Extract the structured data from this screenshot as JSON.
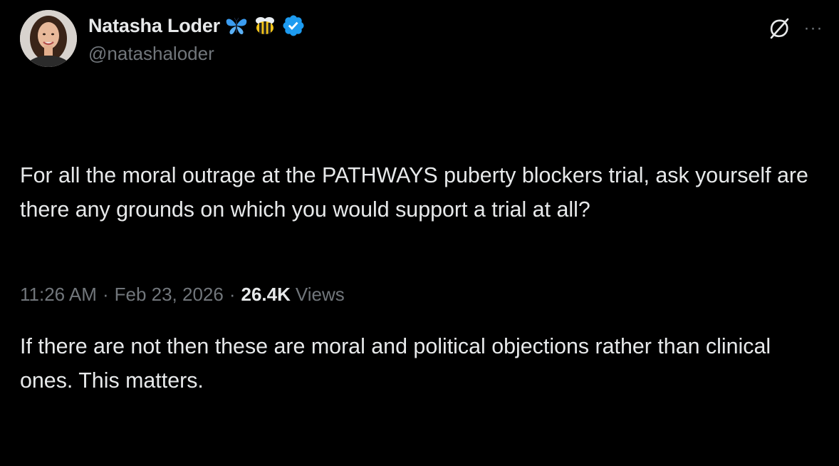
{
  "tweet": {
    "author": {
      "display_name": "Natasha Loder",
      "handle": "@natashaloder",
      "emojis": [
        "butterfly-emoji",
        "bee-emoji"
      ],
      "verified_icon": "verified-badge-icon",
      "verified_color": "#1d9bf0"
    },
    "text": {
      "paragraph_1": "For all the moral outrage at the PATHWAYS puberty blockers trial, ask yourself are there any grounds on which you would support a trial at all?",
      "paragraph_2": "If there are not then these are moral and political objections rather than clinical ones. This matters."
    },
    "meta": {
      "time": "11:26 AM",
      "separator": "·",
      "date": "Feb 23, 2026",
      "views_count": "26.4K",
      "views_label": "Views"
    },
    "actions": {
      "grok_icon": "grok-icon",
      "more_icon": "more-options-icon",
      "more_glyph": "···"
    }
  },
  "colors": {
    "background": "#000000",
    "primary_text": "#e7e9ea",
    "secondary_text": "#71767b",
    "accent": "#1d9bf0"
  }
}
